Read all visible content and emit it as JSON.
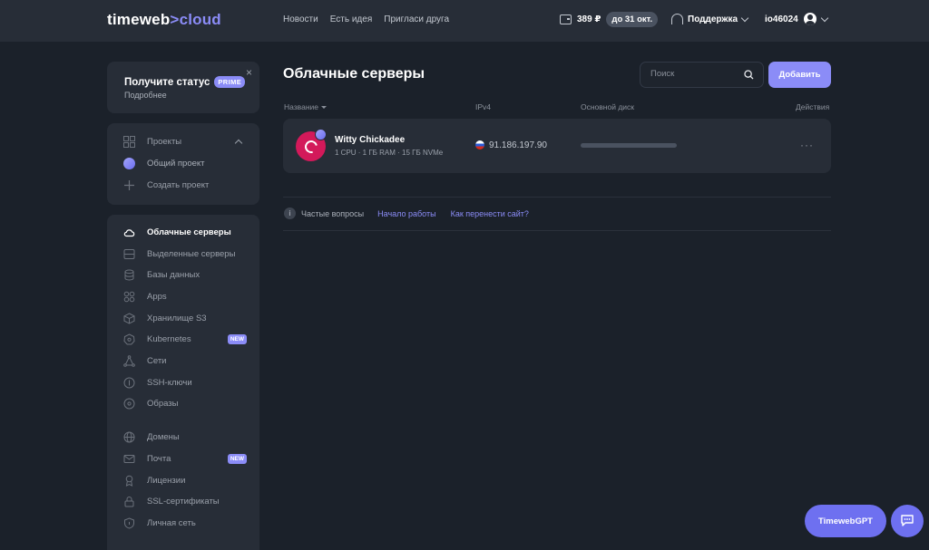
{
  "header": {
    "logo_main": "timeweb",
    "logo_sep": ">",
    "logo_accent": "cloud",
    "nav": [
      "Новости",
      "Есть идея",
      "Пригласи друга"
    ],
    "balance": "389 ₽",
    "balance_until": "до 31 окт.",
    "support_label": "Поддержка",
    "username": "io46024"
  },
  "promo": {
    "title": "Получите статус",
    "badge": "PRIME",
    "subtitle": "Подробнее",
    "close": "×"
  },
  "projects": {
    "header": "Проекты",
    "items": [
      {
        "label": "Общий проект",
        "icon": "project-dot-icon"
      },
      {
        "label": "Создать проект",
        "icon": "plus-icon"
      }
    ]
  },
  "sidebar": {
    "groups": [
      [
        {
          "label": "Облачные серверы",
          "icon": "cloud-icon",
          "active": true
        },
        {
          "label": "Выделенные серверы",
          "icon": "server-icon"
        },
        {
          "label": "Базы данных",
          "icon": "database-icon"
        },
        {
          "label": "Apps",
          "icon": "apps-icon"
        },
        {
          "label": "Хранилище S3",
          "icon": "storage-icon"
        },
        {
          "label": "Kubernetes",
          "icon": "kubernetes-icon",
          "badge": "NEW"
        },
        {
          "label": "Сети",
          "icon": "network-icon"
        },
        {
          "label": "SSH-ключи",
          "icon": "key-icon"
        },
        {
          "label": "Образы",
          "icon": "image-icon"
        }
      ],
      [
        {
          "label": "Домены",
          "icon": "globe-icon"
        },
        {
          "label": "Почта",
          "icon": "mail-icon",
          "badge": "NEW"
        },
        {
          "label": "Лицензии",
          "icon": "license-icon"
        },
        {
          "label": "SSL-сертификаты",
          "icon": "lock-icon"
        },
        {
          "label": "Личная сеть",
          "icon": "shield-icon"
        }
      ]
    ]
  },
  "main": {
    "title": "Облачные серверы",
    "search_placeholder": "Поиск",
    "add_button": "Добавить",
    "columns": {
      "name": "Название",
      "ipv4": "IPv4",
      "disk": "Основной диск",
      "actions": "Действия"
    },
    "servers": [
      {
        "name": "Witty Chickadee",
        "spec": "1 CPU · 1 ГБ RAM · 15 ГБ NVMe",
        "ip": "91.186.197.90",
        "disk_used_fraction": 0,
        "actions": "···"
      }
    ],
    "faq": {
      "label": "Частые вопросы",
      "links": [
        "Начало работы",
        "Как перенести сайт?"
      ]
    }
  },
  "floating": {
    "gpt_button": "TimewebGPT"
  },
  "colors": {
    "accent": "#8b8cf7",
    "background": "#1b212a",
    "panel": "#272d37",
    "debian": "#d3195a"
  }
}
